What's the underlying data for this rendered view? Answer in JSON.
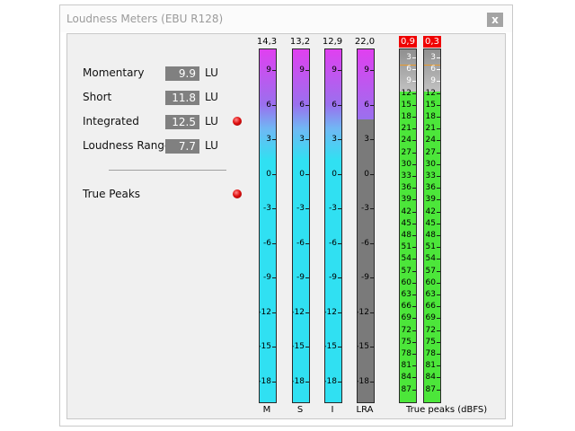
{
  "window": {
    "title": "Loudness Meters (EBU R128)",
    "close_label": "x"
  },
  "readouts": [
    {
      "label": "Momentary",
      "value": "9.9",
      "unit": "LU",
      "led": false
    },
    {
      "label": "Short",
      "value": "11.8",
      "unit": "LU",
      "led": false
    },
    {
      "label": "Integrated",
      "value": "12.5",
      "unit": "LU",
      "led": true
    },
    {
      "label": "Loudness Range",
      "value": "7.7",
      "unit": "LU",
      "led": false
    }
  ],
  "true_peaks": {
    "label": "True Peaks",
    "led": true,
    "led_color": "#e01010"
  },
  "loudness_meters": {
    "scale_lu": [
      "9",
      "6",
      "3",
      "0",
      "-3",
      "-6",
      "-9",
      "-12",
      "-15",
      "-18"
    ],
    "scale_top_lu": 10.8,
    "scale_bottom_lu": -19.8,
    "meters": [
      {
        "name": "M",
        "peak_readout": "14,3",
        "level_lu": 11.0,
        "style": "gradient"
      },
      {
        "name": "S",
        "peak_readout": "13,2",
        "level_lu": 11.0,
        "style": "gradient"
      },
      {
        "name": "I",
        "peak_readout": "12,9",
        "level_lu": 11.0,
        "style": "gradient"
      },
      {
        "name": "LRA",
        "peak_readout": "22,0",
        "level_lu": 4.7,
        "style": "lra"
      }
    ],
    "colors": {
      "magenta": "#e040f0",
      "violet": "#9a70ee",
      "cyan": "#30e0f2",
      "gray": "#7a7a7a"
    }
  },
  "peak_meters": {
    "caption": "True peaks (dBFS)",
    "scale_dbfs": [
      "3",
      "6",
      "9",
      "12",
      "15",
      "18",
      "21",
      "24",
      "27",
      "30",
      "33",
      "36",
      "39",
      "42",
      "45",
      "48",
      "51",
      "54",
      "57",
      "60",
      "63",
      "66",
      "69",
      "72",
      "75",
      "78",
      "81",
      "84",
      "87"
    ],
    "gray_zone_until": "9",
    "meters": [
      {
        "channel": "left",
        "peak_readout": "0,9"
      },
      {
        "channel": "right",
        "peak_readout": "0,3"
      }
    ],
    "colors": {
      "green": "#4ce63a",
      "gray": "#a0a0a0",
      "peak_red": "#ef0000",
      "marker": "#e89a2a"
    }
  }
}
